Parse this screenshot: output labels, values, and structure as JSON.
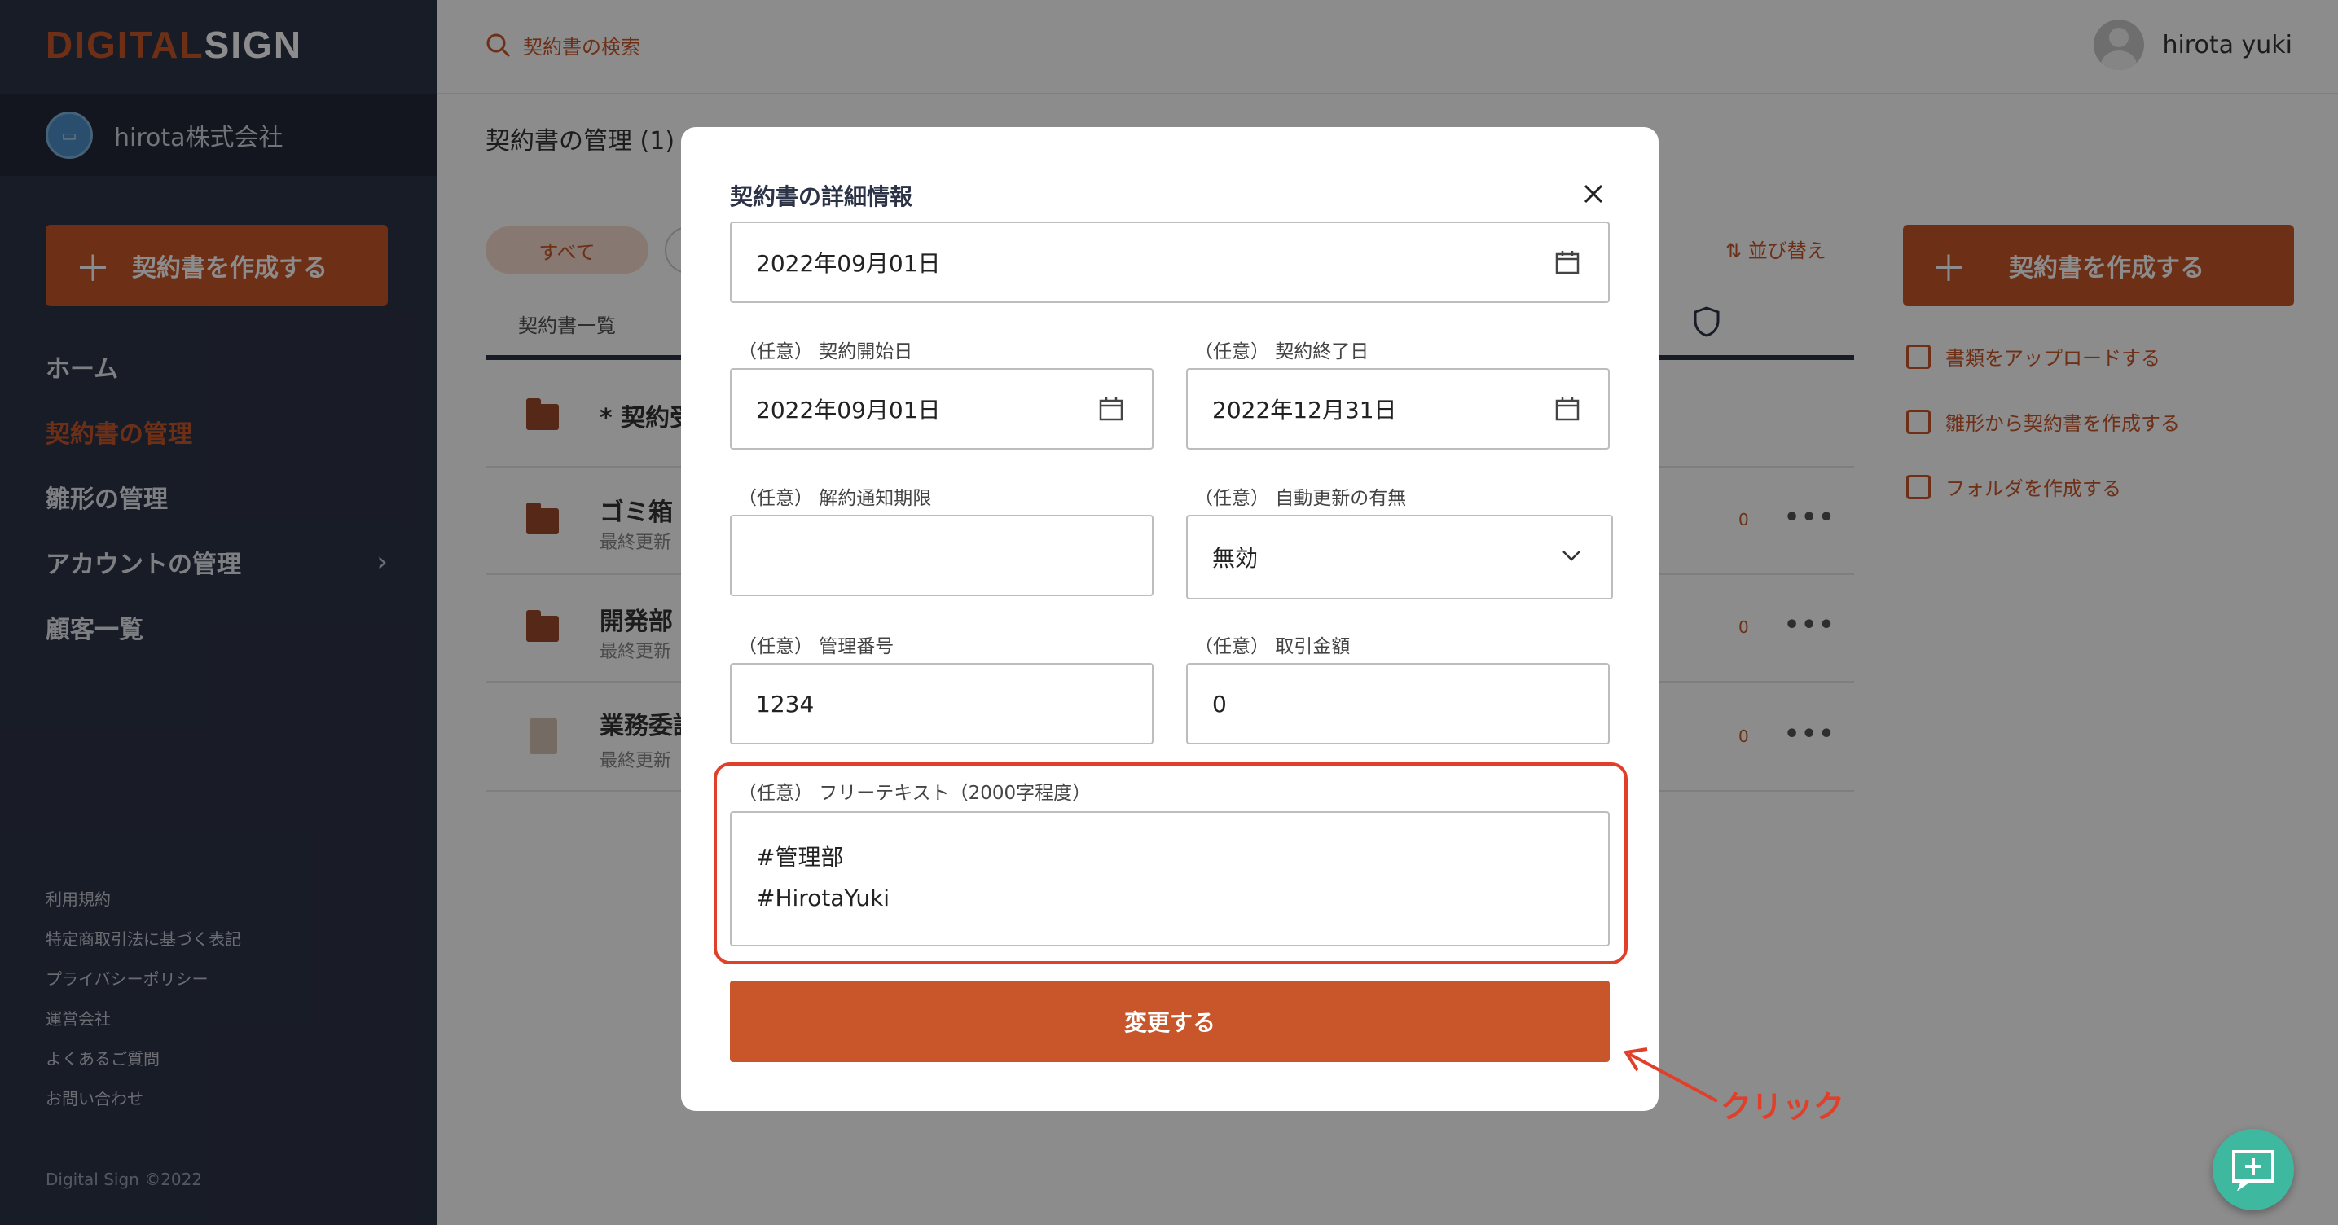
{
  "app": {
    "logo_part1": "DIGITAL",
    "logo_part2": "SIGN"
  },
  "sidebar": {
    "company_name": "hirota株式会社",
    "create_button": "契約書を作成する",
    "nav": [
      {
        "label": "ホーム"
      },
      {
        "label": "契約書の管理"
      },
      {
        "label": "雛形の管理"
      },
      {
        "label": "アカウントの管理"
      },
      {
        "label": "顧客一覧"
      }
    ],
    "footer_links": [
      "利用規約",
      "特定商取引法に基づく表記",
      "プライバシーポリシー",
      "運営会社",
      "よくあるご質問",
      "お問い合わせ"
    ],
    "copyright": "Digital Sign ©2022"
  },
  "topbar": {
    "search_placeholder": "契約書の検索",
    "user_name": "hirota yuki"
  },
  "main": {
    "title": "契約書の管理 (1)",
    "filter_all": "すべて",
    "sort_label": "並び替え",
    "tab_label": "契約書一覧",
    "rows": [
      {
        "title": "* 契約受",
        "sub": ""
      },
      {
        "title": "ゴミ箱",
        "sub": "最終更新",
        "count": "0"
      },
      {
        "title": "開発部",
        "sub": "最終更新",
        "count": "0"
      },
      {
        "title": "業務委託",
        "sub": "最終更新",
        "count": "0"
      }
    ]
  },
  "right_panel": {
    "create_button": "契約書を作成する",
    "links": [
      "書類をアップロードする",
      "雛形から契約書を作成する",
      "フォルダを作成する"
    ]
  },
  "modal": {
    "title": "契約書の詳細情報",
    "contract_date": "2022年09月01日",
    "start_label": "（任意） 契約開始日",
    "start_value": "2022年09月01日",
    "end_label": "（任意） 契約終了日",
    "end_value": "2022年12月31日",
    "notice_label": "（任意） 解約通知期限",
    "notice_value": "",
    "auto_renew_label": "（任意） 自動更新の有無",
    "auto_renew_value": "無効",
    "mgmt_no_label": "（任意） 管理番号",
    "mgmt_no_value": "1234",
    "amount_label": "（任意） 取引金額",
    "amount_value": "0",
    "free_text_label": "（任意） フリーテキスト（2000字程度）",
    "free_text_line1": "#管理部",
    "free_text_line2": "#HirotaYuki",
    "submit_label": "変更する"
  },
  "annotation": {
    "text": "クリック"
  }
}
